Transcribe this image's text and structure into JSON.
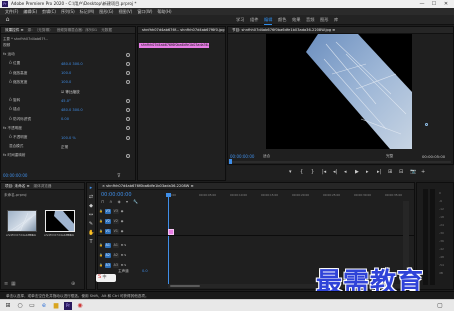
{
  "titlebar": {
    "text": "Adobe Premiere Pro 2020 - C:\\用户\\Desktop\\新建项目.prproj *",
    "minimize": "—",
    "maximize": "☐",
    "close": "✕"
  },
  "menubar": {
    "items": [
      "文件(F)",
      "编辑(E)",
      "剪辑(C)",
      "序列(S)",
      "标记(M)",
      "图形(G)",
      "视图(V)",
      "窗口(W)",
      "帮助(H)"
    ]
  },
  "workspaces": {
    "items": [
      "学习",
      "组件",
      "编辑",
      "颜色",
      "效果",
      "音频",
      "图形",
      "库"
    ],
    "active_index": 2
  },
  "effect_controls": {
    "tabs": [
      "效果控件 ≡",
      "源：（无剪辑）",
      "音频剪辑混合器：序列01",
      "元数据"
    ],
    "source_label": "主要 * shnfhh07d4ab67f...",
    "seq_label": "shnfhh07d4ab676f... shnfhh07d4ab67f6f0.jpg",
    "clip_label": "shnfhh07d4ab676f6f0ba6dfe1b03ada36-2208W.jpg",
    "rows": [
      {
        "label": "视频",
        "value": ""
      },
      {
        "label": "fx  运动",
        "value": ""
      },
      {
        "label": "Ö 位置",
        "value": "480.0      300.0"
      },
      {
        "label": "Ö 缩放高度",
        "value": "100.0"
      },
      {
        "label": "Ö 缩放宽度",
        "value": "100.0"
      },
      {
        "label": "",
        "value": "☑ 等比缩放"
      },
      {
        "label": "Ö 旋转",
        "value": "45.0°"
      },
      {
        "label": "Ö 锚点",
        "value": "480.0      300.0"
      },
      {
        "label": "Ö 防闪烁滤镜",
        "value": "0.00"
      },
      {
        "label": "fx  不透明度",
        "value": ""
      },
      {
        "label": "Ö 不透明度",
        "value": "100.0 %"
      },
      {
        "label": "混合模式",
        "value": "正常"
      },
      {
        "label": "fx  时间重映射",
        "value": ""
      }
    ],
    "time": "00:00:00:00"
  },
  "program": {
    "tab_label": "节目: shnfhh07d4ab676f0ba6dfe1b03ada36-2208W.jpg ≡",
    "timecode": "00:00:00:00",
    "fit_label": "适合",
    "quality_label": "完整",
    "duration": "00:00:05:00"
  },
  "transport": {
    "buttons": [
      "▾",
      "{",
      "}",
      "|◂",
      "◂|",
      "◂",
      "▶",
      "▸",
      "▸|",
      "⊞",
      "⊟",
      "📷",
      "+"
    ]
  },
  "project": {
    "tabs": [
      "项目: 未命名 ≡",
      "媒体浏览器"
    ],
    "bin_label": "未命名.prproj",
    "items": [
      {
        "name": "shnfhh07d4ab676...",
        "duration": "5:00"
      },
      {
        "name": "shnfhh07d4ab676...",
        "duration": "5:00"
      }
    ]
  },
  "tools": [
    "▸",
    "⇄",
    "◆",
    "↔",
    "✎",
    "✋",
    "T"
  ],
  "timeline": {
    "tab_label": "× shnfhh07d4ab676f0ba6dfe1b03ada36-2208W ≡",
    "timecode": "00:00:00:00",
    "ruler": [
      "00:00",
      "00:00:05:00",
      "00:00:10:00",
      "00:00:15:00",
      "00:00:20:00",
      "00:00:25:00",
      "00:00:30:00",
      "00:00:35:00"
    ],
    "tracks": [
      {
        "name": "V3",
        "type": "video"
      },
      {
        "name": "V2",
        "type": "video"
      },
      {
        "name": "V1",
        "type": "video"
      },
      {
        "name": "A1",
        "type": "audio"
      },
      {
        "name": "A2",
        "type": "audio"
      },
      {
        "name": "A3",
        "type": "audio"
      }
    ],
    "master_label": "主声道",
    "master_value": "0.0"
  },
  "status": {
    "text": "单击以选择，或单击空白处并拖动以进行框选。使用 Shift、Alt 和 Ctrl 可获得其他选项。"
  },
  "watermark": {
    "text": "最需教育"
  },
  "colors": {
    "accent": "#2d8ceb",
    "clip": "#e87de6",
    "watermark": "#2f43d8"
  }
}
